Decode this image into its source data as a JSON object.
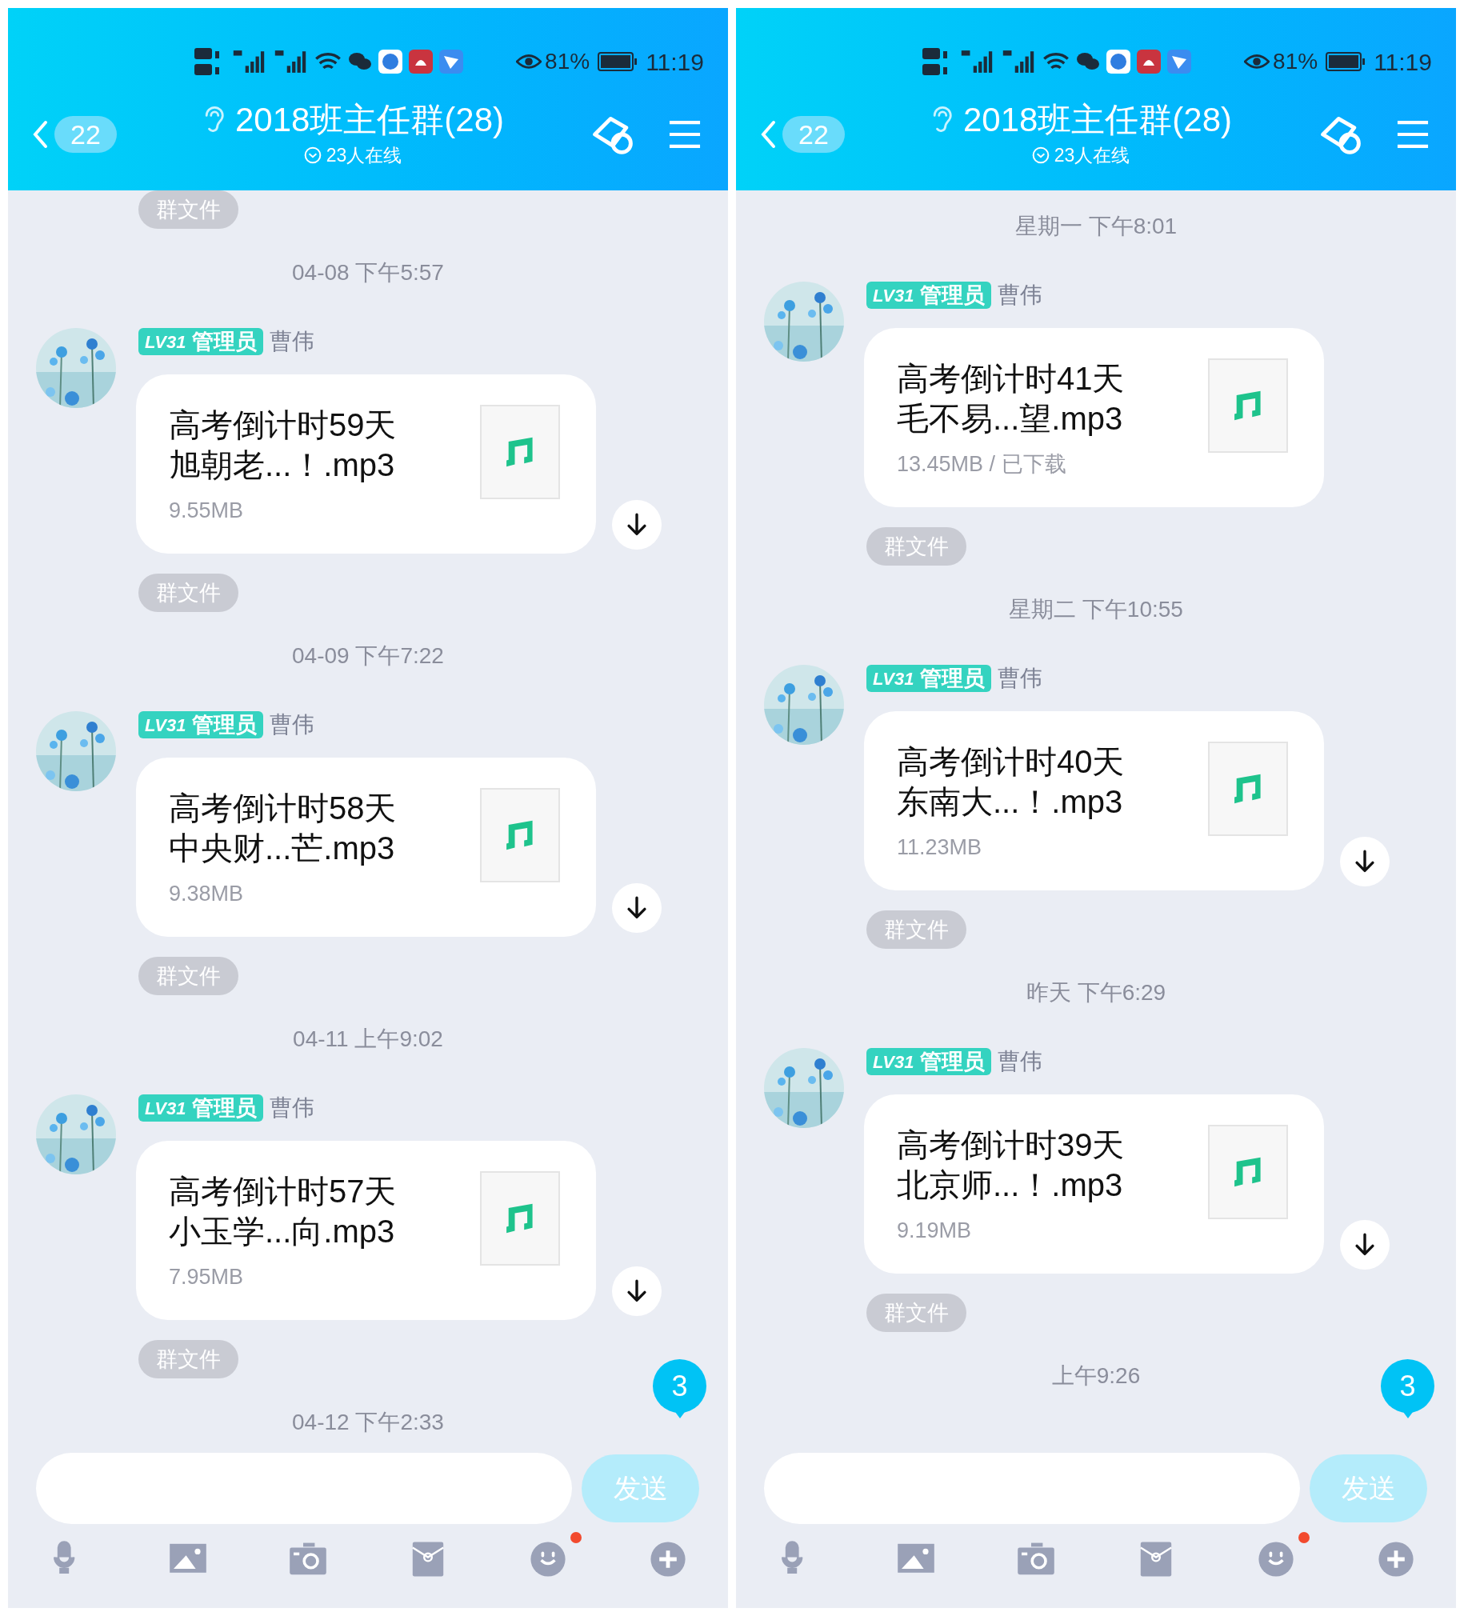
{
  "panels": [
    {
      "status_bar": {
        "battery": "81%",
        "time": "11:19"
      },
      "header": {
        "back_count": "22",
        "title": "2018班主任群(28)",
        "online": "23人在线"
      },
      "items": [
        {
          "kind": "file_tag",
          "label": "群文件"
        },
        {
          "kind": "timestamp",
          "text": "04-08 下午5:57"
        },
        {
          "kind": "file_message",
          "level": "LV31",
          "role": "管理员",
          "sender": "曹伟",
          "lines": [
            "高考倒计时59天",
            "旭朝老...！.mp3"
          ],
          "size": "9.55MB",
          "downloadable": true
        },
        {
          "kind": "file_tag",
          "label": "群文件"
        },
        {
          "kind": "timestamp",
          "text": "04-09 下午7:22"
        },
        {
          "kind": "file_message",
          "level": "LV31",
          "role": "管理员",
          "sender": "曹伟",
          "lines": [
            "高考倒计时58天",
            "中央财...芒.mp3"
          ],
          "size": "9.38MB",
          "downloadable": true
        },
        {
          "kind": "file_tag",
          "label": "群文件"
        },
        {
          "kind": "timestamp",
          "text": "04-11 上午9:02"
        },
        {
          "kind": "file_message",
          "level": "LV31",
          "role": "管理员",
          "sender": "曹伟",
          "lines": [
            "高考倒计时57天",
            "小玉学...向.mp3"
          ],
          "size": "7.95MB",
          "downloadable": true
        },
        {
          "kind": "file_tag",
          "label": "群文件"
        },
        {
          "kind": "timestamp",
          "text": "04-12 下午2:33"
        }
      ],
      "unread_count": "3",
      "composer": {
        "send_label": "发送"
      }
    },
    {
      "status_bar": {
        "battery": "81%",
        "time": "11:19"
      },
      "header": {
        "back_count": "22",
        "title": "2018班主任群(28)",
        "online": "23人在线"
      },
      "items": [
        {
          "kind": "timestamp",
          "text": "星期一 下午8:01"
        },
        {
          "kind": "file_message",
          "level": "LV31",
          "role": "管理员",
          "sender": "曹伟",
          "lines": [
            "高考倒计时41天",
            "毛不易...望.mp3"
          ],
          "size": "13.45MB / 已下载",
          "downloadable": false
        },
        {
          "kind": "file_tag",
          "label": "群文件"
        },
        {
          "kind": "timestamp",
          "text": "星期二 下午10:55"
        },
        {
          "kind": "file_message",
          "level": "LV31",
          "role": "管理员",
          "sender": "曹伟",
          "lines": [
            "高考倒计时40天",
            "东南大...！.mp3"
          ],
          "size": "11.23MB",
          "downloadable": true
        },
        {
          "kind": "file_tag",
          "label": "群文件"
        },
        {
          "kind": "timestamp",
          "text": "昨天 下午6:29"
        },
        {
          "kind": "file_message",
          "level": "LV31",
          "role": "管理员",
          "sender": "曹伟",
          "lines": [
            "高考倒计时39天",
            "北京师...！.mp3"
          ],
          "size": "9.19MB",
          "downloadable": true
        },
        {
          "kind": "file_tag",
          "label": "群文件"
        },
        {
          "kind": "timestamp",
          "text": "上午9:26"
        }
      ],
      "unread_count": "3",
      "composer": {
        "send_label": "发送"
      }
    }
  ]
}
